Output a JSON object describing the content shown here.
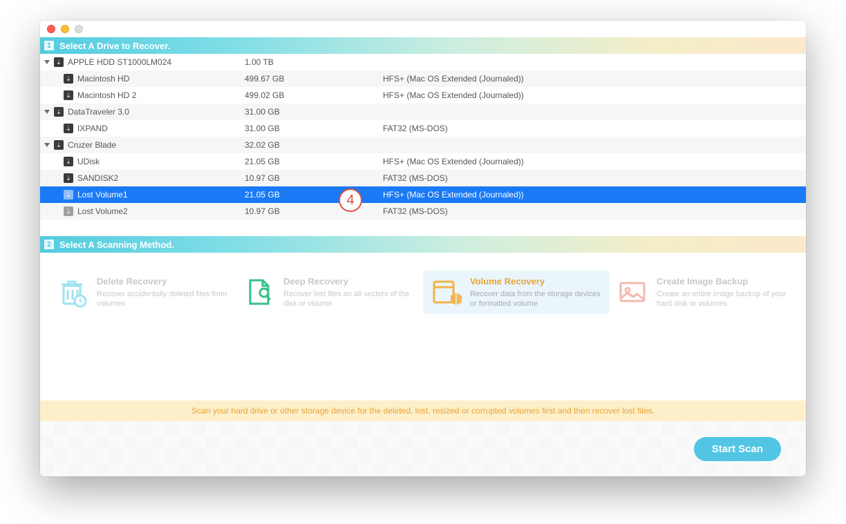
{
  "annotation": {
    "badge": "4"
  },
  "section1": {
    "num": "1",
    "title": "Select A Drive to Recover."
  },
  "section2": {
    "num": "2",
    "title": "Select A Scanning Method."
  },
  "drives": [
    {
      "name": "APPLE HDD ST1000LM024",
      "size": "1.00 TB",
      "fs": "",
      "level": 0,
      "expand": true,
      "striped": false,
      "selected": false,
      "icon": "dark"
    },
    {
      "name": "Macintosh HD",
      "size": "499.67 GB",
      "fs": "HFS+ (Mac OS Extended (Journaled))",
      "level": 1,
      "expand": false,
      "striped": true,
      "selected": false,
      "icon": "dark"
    },
    {
      "name": "Macintosh HD 2",
      "size": "499.02 GB",
      "fs": "HFS+ (Mac OS Extended (Journaled))",
      "level": 1,
      "expand": false,
      "striped": false,
      "selected": false,
      "icon": "dark"
    },
    {
      "name": "DataTraveler 3.0",
      "size": "31.00 GB",
      "fs": "",
      "level": 0,
      "expand": true,
      "striped": true,
      "selected": false,
      "icon": "dark"
    },
    {
      "name": "IXPAND",
      "size": "31.00 GB",
      "fs": "FAT32 (MS-DOS)",
      "level": 1,
      "expand": false,
      "striped": false,
      "selected": false,
      "icon": "dark"
    },
    {
      "name": "Cruzer Blade",
      "size": "32.02 GB",
      "fs": "",
      "level": 0,
      "expand": true,
      "striped": true,
      "selected": false,
      "icon": "dark"
    },
    {
      "name": "UDisk",
      "size": "21.05 GB",
      "fs": "HFS+ (Mac OS Extended (Journaled))",
      "level": 1,
      "expand": false,
      "striped": false,
      "selected": false,
      "icon": "dark"
    },
    {
      "name": "SANDISK2",
      "size": "10.97 GB",
      "fs": "FAT32 (MS-DOS)",
      "level": 1,
      "expand": false,
      "striped": true,
      "selected": false,
      "icon": "dark"
    },
    {
      "name": "Lost Volume1",
      "size": "21.05 GB",
      "fs": "HFS+ (Mac OS Extended (Journaled))",
      "level": 1,
      "expand": false,
      "striped": false,
      "selected": true,
      "icon": "gray"
    },
    {
      "name": "Lost Volume2",
      "size": "10.97 GB",
      "fs": "FAT32 (MS-DOS)",
      "level": 1,
      "expand": false,
      "striped": true,
      "selected": false,
      "icon": "gray"
    }
  ],
  "methods": {
    "delete": {
      "title": "Delete Recovery",
      "desc": "Recover accidentally deleted files from volumes"
    },
    "deep": {
      "title": "Deep Recovery",
      "desc": "Recover lost files on all sectors of the disk or vloume"
    },
    "volume": {
      "title": "Volume Recovery",
      "desc": "Recover data from the storage devices or formatted volume"
    },
    "image": {
      "title": "Create Image Backup",
      "desc": "Create an entire image backup of your hard disk or volumes"
    }
  },
  "hint": "Scan your hard drive or other storage device for the deleted, lost, resized or corrupted volumes first and then recover lost files.",
  "footer": {
    "start": "Start Scan"
  }
}
